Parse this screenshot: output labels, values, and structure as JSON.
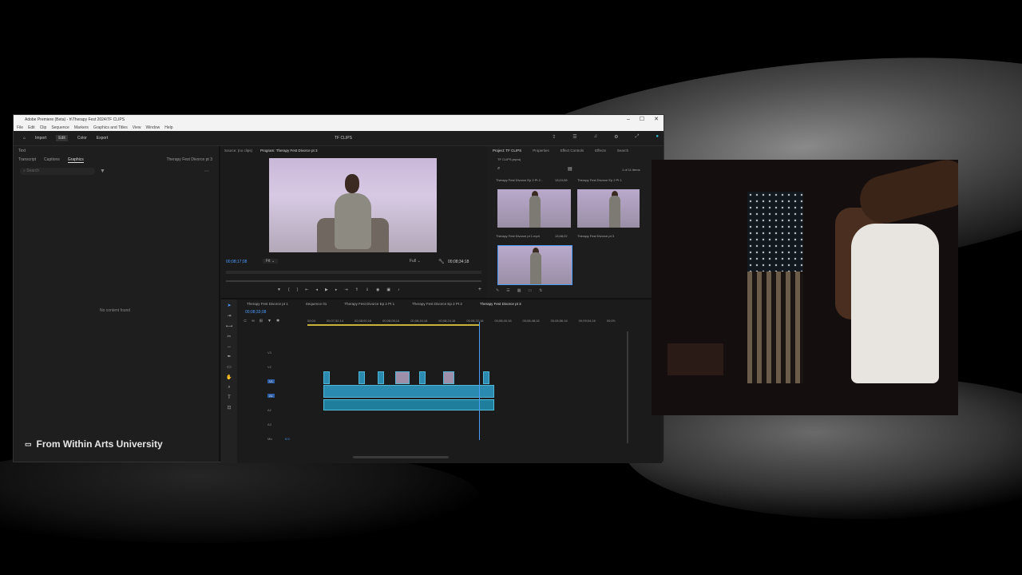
{
  "window": {
    "title": "Adobe Premiere (Beta) - h\\Therapy Fest 2024\\TF CLIPS",
    "menu": [
      "File",
      "Edit",
      "Clip",
      "Sequence",
      "Markers",
      "Graphics and Titles",
      "View",
      "Window",
      "Help"
    ],
    "header_tabs": [
      "Import",
      "Edit",
      "Color",
      "Export"
    ],
    "project_name": "TF CLIPS"
  },
  "left_panel": {
    "top_label": "Text",
    "tabs": [
      "Transcript",
      "Captions",
      "Graphics"
    ],
    "active_tab": "Graphics",
    "sequence_label": "Therapy Fest Divorce pt 3",
    "search_placeholder": "Search",
    "empty_text": "No content found",
    "brand": "From Within Arts University"
  },
  "monitor": {
    "source_tab": "Source: (no clips)",
    "program_tab": "Program: Therapy Fest Divorce pt 3",
    "timecode_in": "00;08;17;08",
    "fit": "Fit",
    "quality": "Full",
    "timecode_out": "00;08;34;18"
  },
  "project_panel": {
    "tabs": [
      "Project: TF CLIPS",
      "Properties",
      "Effect Controls",
      "Effects",
      "Search"
    ],
    "bin_label": "TF CLIPS.prproj",
    "count": "1 of 11 items",
    "items": [
      {
        "name": "Therapy Fest Divorce Ep 2 Pt 2...",
        "duration": "13;10;06"
      },
      {
        "name": "Therapy Fest Divorce Ep 2 Pt 1",
        "duration": ""
      },
      {
        "name": "Therapy Fest Divorce pt 1.mp4",
        "duration": "13;48;22"
      },
      {
        "name": "Therapy Fest Divorce pt 3",
        "duration": ""
      }
    ]
  },
  "timeline": {
    "seq_tabs": [
      "Therapy Fest Divorce pt 1",
      "Sequence 01",
      "Therapy Fest Divorce Ep 2 Pt 1",
      "Therapy Fest Divorce Ep 2 Pt 2",
      "Therapy Fest Divorce pt 3"
    ],
    "timecode": "00;08;33;08",
    "ruler": [
      "00;04",
      "00;07;52;14",
      "00;08;00;16",
      "00;08;08;16",
      "00;08;16;16",
      "00;08;24;16",
      "00;08;32;16",
      "00;08;40;16",
      "00;08;48;16",
      "00;08;56;16",
      "00;09;04;16",
      "00;09;"
    ],
    "tracks": [
      "V3",
      "V2",
      "V1",
      "A1",
      "A2",
      "A3",
      "Mix"
    ],
    "mix_value": "0.0"
  },
  "colors": {
    "accent": "#4b9cff",
    "clip": "#2a8ab0",
    "panel": "#1d1d1d"
  }
}
